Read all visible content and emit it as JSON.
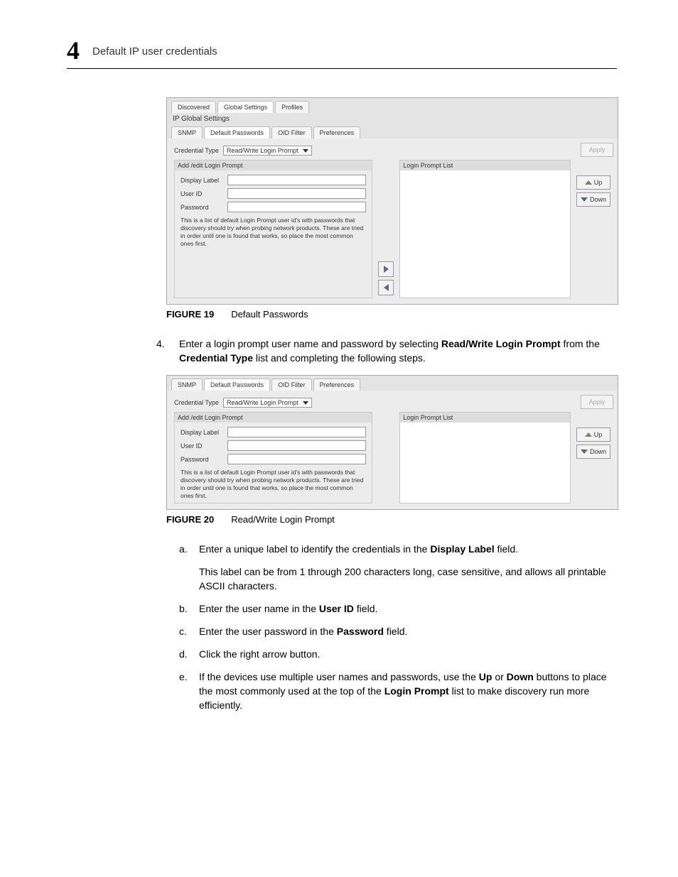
{
  "header": {
    "chapter_number": "4",
    "title": "Default IP user credentials"
  },
  "figure1": {
    "tabs_outer": [
      "Discovered",
      "Global Settings",
      "Profiles"
    ],
    "ip_global_label": "IP Global Settings",
    "tabs_inner": [
      "SNMP",
      "Default Passwords",
      "OID Filter",
      "Preferences"
    ],
    "apply": "Apply",
    "credential_type_label": "Credential Type",
    "credential_type_value": "Read/Write Login Prompt",
    "left_header": "Add /edit Login Prompt",
    "right_header": "Login Prompt List",
    "display_label": "Display Label",
    "user_id": "User ID",
    "password": "Password",
    "helptext": "This is a list of default Login Prompt user id's with passwords that discovery should try when probing network products. These are tried in order until one is found that works, so place the most common ones first.",
    "up": "Up",
    "down": "Down",
    "caption_num": "FIGURE 19",
    "caption_title": "Default Passwords"
  },
  "step4": {
    "num": "4.",
    "text_a": "Enter a login prompt user name and password by selecting ",
    "bold1": "Read/Write Login Prompt",
    "text_b": " from the ",
    "bold2": "Credential Type",
    "text_c": " list and completing the following steps."
  },
  "figure2": {
    "tabs_inner": [
      "SNMP",
      "Default Passwords",
      "OID Filter",
      "Preferences"
    ],
    "apply": "Apply",
    "credential_type_label": "Credential Type",
    "credential_type_value": "Read/Write Login Prompt",
    "left_header": "Add /edit Login Prompt",
    "right_header": "Login Prompt List",
    "display_label": "Display Label",
    "user_id": "User ID",
    "password": "Password",
    "helptext": "This is a list of default Login Prompt user id's with passwords that discovery should try when probing network products. These are tried in order until one is found that works, so place the most common ones first.",
    "up": "Up",
    "down": "Down",
    "caption_num": "FIGURE 20",
    "caption_title": "Read/Write Login Prompt"
  },
  "sub_a": {
    "letter": "a.",
    "t1": "Enter a unique label to identify the credentials in the ",
    "b1": "Display Label",
    "t2": " field.",
    "follow": "This label can be from 1 through 200 characters long, case sensitive, and allows all printable ASCII characters."
  },
  "sub_b": {
    "letter": "b.",
    "t1": "Enter the user name in the ",
    "b1": "User ID",
    "t2": " field."
  },
  "sub_c": {
    "letter": "c.",
    "t1": "Enter the user password in the ",
    "b1": "Password",
    "t2": " field."
  },
  "sub_d": {
    "letter": "d.",
    "t1": "Click the right arrow button."
  },
  "sub_e": {
    "letter": "e.",
    "t1": "If the devices use multiple user names and passwords, use the ",
    "b1": "Up",
    "t2": " or ",
    "b2": "Down",
    "t3": " buttons to place the most commonly used at the top of the ",
    "b3": "Login Prompt",
    "t4": " list to make discovery run more efficiently."
  }
}
